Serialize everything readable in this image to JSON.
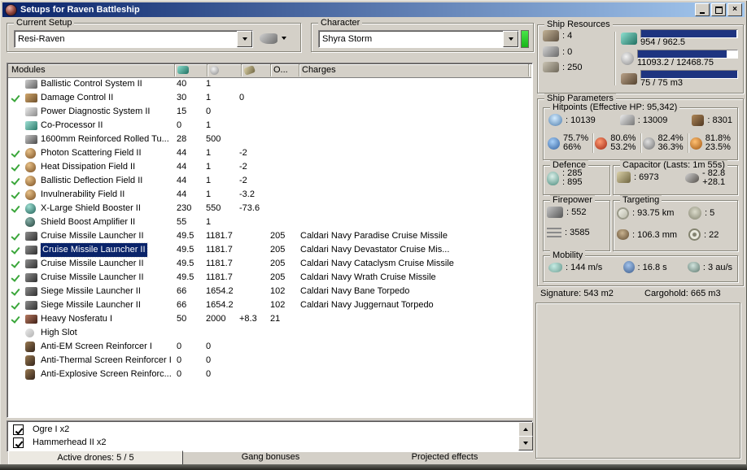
{
  "window": {
    "title": "Setups for Raven Battleship"
  },
  "current_setup": {
    "label": "Current Setup",
    "value": "Resi-Raven"
  },
  "character": {
    "label": "Character",
    "value": "Shyra Storm"
  },
  "modules_table": {
    "headers": {
      "modules": "Modules",
      "ammo": "O...",
      "charges": "Charges"
    },
    "rows": [
      {
        "active": false,
        "selected": false,
        "icon": "bcs",
        "name": "Ballistic Control System II",
        "cpu": "40",
        "pg": "1",
        "cap": "",
        "ammo": "",
        "charge": ""
      },
      {
        "active": true,
        "selected": false,
        "icon": "dcu",
        "name": "Damage Control II",
        "cpu": "30",
        "pg": "1",
        "cap": "0",
        "ammo": "",
        "charge": ""
      },
      {
        "active": false,
        "selected": false,
        "icon": "pds",
        "name": "Power Diagnostic System II",
        "cpu": "15",
        "pg": "0",
        "cap": "",
        "ammo": "",
        "charge": ""
      },
      {
        "active": false,
        "selected": false,
        "icon": "chip",
        "name": "Co-Processor II",
        "cpu": "0",
        "pg": "1",
        "cap": "",
        "ammo": "",
        "charge": ""
      },
      {
        "active": false,
        "selected": false,
        "icon": "plate",
        "name": "1600mm Reinforced Rolled Tu...",
        "cpu": "28",
        "pg": "500",
        "cap": "",
        "ammo": "",
        "charge": ""
      },
      {
        "active": true,
        "selected": false,
        "icon": "shieldh",
        "name": "Photon Scattering Field II",
        "cpu": "44",
        "pg": "1",
        "cap": "-2",
        "ammo": "",
        "charge": ""
      },
      {
        "active": true,
        "selected": false,
        "icon": "shieldh",
        "name": "Heat Dissipation Field II",
        "cpu": "44",
        "pg": "1",
        "cap": "-2",
        "ammo": "",
        "charge": ""
      },
      {
        "active": true,
        "selected": false,
        "icon": "shieldh",
        "name": "Ballistic Deflection Field II",
        "cpu": "44",
        "pg": "1",
        "cap": "-2",
        "ammo": "",
        "charge": ""
      },
      {
        "active": true,
        "selected": false,
        "icon": "shieldh",
        "name": "Invulnerability Field II",
        "cpu": "44",
        "pg": "1",
        "cap": "-3.2",
        "ammo": "",
        "charge": ""
      },
      {
        "active": true,
        "selected": false,
        "icon": "boost",
        "name": "X-Large Shield Booster II",
        "cpu": "230",
        "pg": "550",
        "cap": "-73.6",
        "ammo": "",
        "charge": ""
      },
      {
        "active": false,
        "selected": false,
        "icon": "amp",
        "name": "Shield Boost Amplifier II",
        "cpu": "55",
        "pg": "1",
        "cap": "",
        "ammo": "",
        "charge": ""
      },
      {
        "active": true,
        "selected": false,
        "icon": "lnch",
        "name": "Cruise Missile Launcher II",
        "cpu": "49.5",
        "pg": "1181.7",
        "cap": "",
        "ammo": "205",
        "charge": "Caldari Navy Paradise Cruise Missile"
      },
      {
        "active": true,
        "selected": true,
        "icon": "lnch",
        "name": "Cruise Missile Launcher II",
        "cpu": "49.5",
        "pg": "1181.7",
        "cap": "",
        "ammo": "205",
        "charge": "Caldari Navy Devastator Cruise Mis..."
      },
      {
        "active": true,
        "selected": false,
        "icon": "lnch",
        "name": "Cruise Missile Launcher II",
        "cpu": "49.5",
        "pg": "1181.7",
        "cap": "",
        "ammo": "205",
        "charge": "Caldari Navy Cataclysm Cruise Missile"
      },
      {
        "active": true,
        "selected": false,
        "icon": "lnch",
        "name": "Cruise Missile Launcher II",
        "cpu": "49.5",
        "pg": "1181.7",
        "cap": "",
        "ammo": "205",
        "charge": "Caldari Navy Wrath Cruise Missile"
      },
      {
        "active": true,
        "selected": false,
        "icon": "lnch",
        "name": "Siege Missile Launcher II",
        "cpu": "66",
        "pg": "1654.2",
        "cap": "",
        "ammo": "102",
        "charge": "Caldari Navy Bane Torpedo"
      },
      {
        "active": true,
        "selected": false,
        "icon": "lnch",
        "name": "Siege Missile Launcher II",
        "cpu": "66",
        "pg": "1654.2",
        "cap": "",
        "ammo": "102",
        "charge": "Caldari Navy Juggernaut Torpedo"
      },
      {
        "active": true,
        "selected": false,
        "icon": "nos",
        "name": "Heavy Nosferatu I",
        "cpu": "50",
        "pg": "2000",
        "cap": "+8.3",
        "ammo": "21",
        "charge": ""
      },
      {
        "active": false,
        "selected": false,
        "icon": "slot",
        "name": "High Slot",
        "cpu": "",
        "pg": "",
        "cap": "",
        "ammo": "",
        "charge": ""
      },
      {
        "active": false,
        "selected": false,
        "icon": "rig",
        "name": "Anti-EM Screen Reinforcer I",
        "cpu": "0",
        "pg": "0",
        "cap": "",
        "ammo": "",
        "charge": ""
      },
      {
        "active": false,
        "selected": false,
        "icon": "rig",
        "name": "Anti-Thermal Screen Reinforcer I",
        "cpu": "0",
        "pg": "0",
        "cap": "",
        "ammo": "",
        "charge": ""
      },
      {
        "active": false,
        "selected": false,
        "icon": "rig",
        "name": "Anti-Explosive Screen Reinforc...",
        "cpu": "0",
        "pg": "0",
        "cap": "",
        "ammo": "",
        "charge": ""
      }
    ]
  },
  "drones": {
    "items": [
      {
        "checked": true,
        "label": "Ogre I x2"
      },
      {
        "checked": true,
        "label": "Hammerhead II x2"
      }
    ]
  },
  "tabs": [
    {
      "label": "Active drones: 5 / 5",
      "active": true
    },
    {
      "label": "Gang bonuses",
      "active": false
    },
    {
      "label": "Projected effects",
      "active": false
    }
  ],
  "ship_resources": {
    "title": "Ship Resources",
    "hardpoints": [
      {
        "icon": "turret",
        "value": ": 4"
      },
      {
        "icon": "launcher",
        "value": ": 0"
      },
      {
        "icon": "rig",
        "value": ": 250"
      }
    ],
    "bars": [
      {
        "icon": "cpu",
        "text": "954 / 962.5",
        "pct": 99.1
      },
      {
        "icon": "powergrid",
        "text": "11093.2 / 12468.75",
        "pct": 89
      },
      {
        "icon": "dronebay",
        "text": "75 / 75 m3",
        "pct": 100
      }
    ],
    "bar_color": "#1e3480"
  },
  "ship_parameters": {
    "title": "Ship Parameters",
    "hitpoints": {
      "title": "Hitpoints (Effective HP: 95,342)",
      "hp": [
        {
          "icon": "shield",
          "value": ": 10139"
        },
        {
          "icon": "armor",
          "value": ": 13009"
        },
        {
          "icon": "structure",
          "value": ": 8301"
        }
      ],
      "resists": [
        {
          "type": "em",
          "top": "75.7%",
          "bottom": "66%"
        },
        {
          "type": "thermal",
          "top": "80.6%",
          "bottom": "53.2%"
        },
        {
          "type": "kinetic",
          "top": "82.4%",
          "bottom": "36.3%"
        },
        {
          "type": "explosive",
          "top": "81.8%",
          "bottom": "23.5%"
        }
      ]
    },
    "defence": {
      "title": "Defence",
      "values": [
        ": 285",
        ": 895"
      ]
    },
    "capacitor": {
      "title": "Capacitor (Lasts: 1m 55s)",
      "amount": ": 6973",
      "peak": "- 82.8",
      "recharge": "+28.1"
    },
    "firepower": {
      "title": "Firepower",
      "rows": [
        {
          "icon": "fturret",
          "value": ": 552"
        },
        {
          "icon": "missiles",
          "value": ": 3585"
        }
      ]
    },
    "targeting": {
      "title": "Targeting",
      "cells": [
        {
          "icon": "range",
          "value": ": 93.75 km"
        },
        {
          "icon": "sensor",
          "value": ": 5"
        },
        {
          "icon": "scanres",
          "value": ": 106.3 mm"
        },
        {
          "icon": "sig",
          "value": ": 22"
        }
      ]
    },
    "mobility": {
      "title": "Mobility",
      "cells": [
        {
          "icon": "speed",
          "value": ": 144 m/s"
        },
        {
          "icon": "align",
          "value": ": 16.8 s"
        },
        {
          "icon": "warp",
          "value": ": 3 au/s"
        }
      ]
    },
    "signature": "Signature: 543 m2",
    "cargohold": "Cargohold: 665 m3"
  }
}
